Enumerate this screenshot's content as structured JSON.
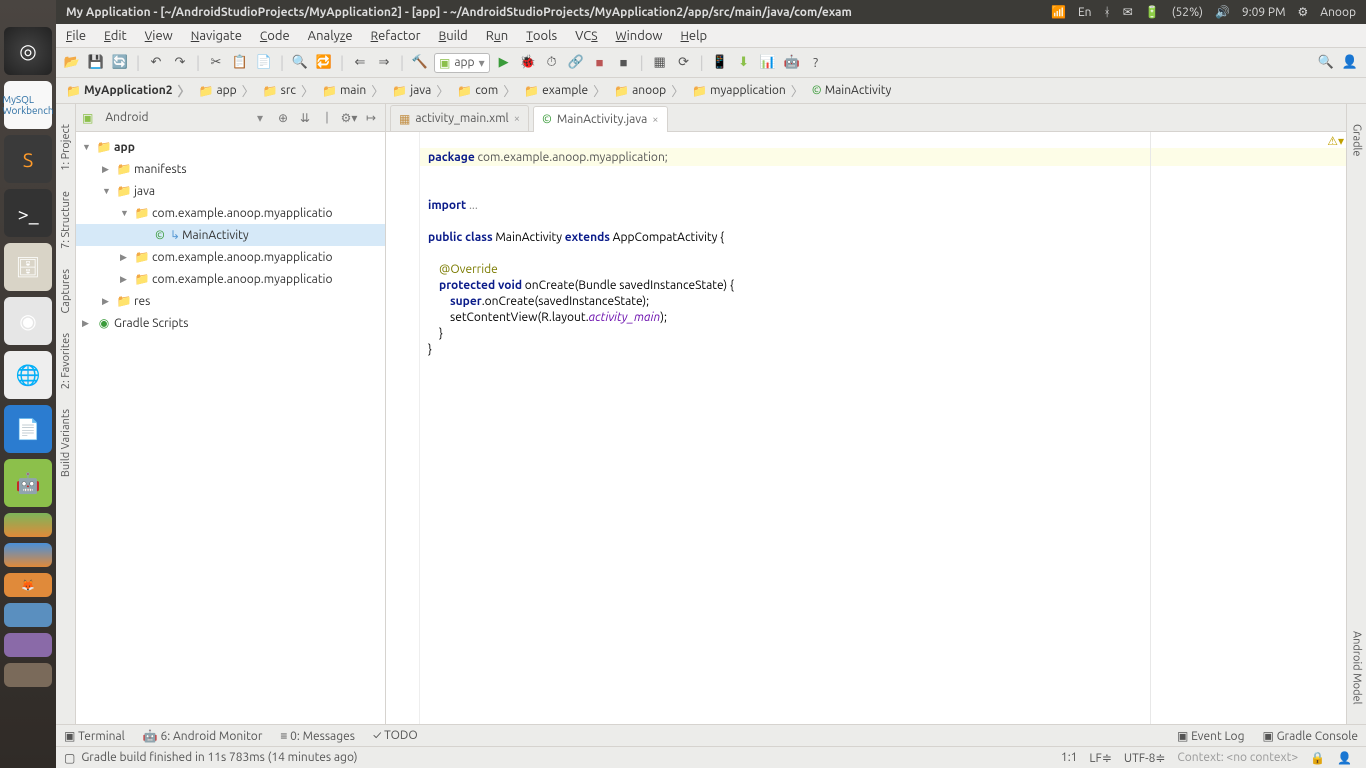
{
  "os": {
    "title": "My Application - [~/AndroidStudioProjects/MyApplication2] - [app] - ~/AndroidStudioProjects/MyApplication2/app/src/main/java/com/exam",
    "lang": "En",
    "battery": "(52%)",
    "time": "9:09 PM",
    "user": "Anoop"
  },
  "menu": {
    "file": "File",
    "edit": "Edit",
    "view": "View",
    "navigate": "Navigate",
    "code": "Code",
    "analyze": "Analyze",
    "refactor": "Refactor",
    "build": "Build",
    "run": "Run",
    "tools": "Tools",
    "vcs": "VCS",
    "window": "Window",
    "help": "Help"
  },
  "run_config": "app",
  "breadcrumb": [
    {
      "label": "MyApplication2",
      "bold": true,
      "icon": "📁"
    },
    {
      "label": "app",
      "icon": "📁"
    },
    {
      "label": "src",
      "icon": "📁"
    },
    {
      "label": "main",
      "icon": "📁"
    },
    {
      "label": "java",
      "icon": "📁"
    },
    {
      "label": "com",
      "icon": "📁"
    },
    {
      "label": "example",
      "icon": "📁"
    },
    {
      "label": "anoop",
      "icon": "📁"
    },
    {
      "label": "myapplication",
      "icon": "📁"
    },
    {
      "label": "MainActivity",
      "icon": "©"
    }
  ],
  "left_strip": [
    "1: Project",
    "7: Structure",
    "Captures",
    "2: Favorites",
    "Build Variants"
  ],
  "right_strip": [
    "Gradle",
    "Android Model"
  ],
  "project": {
    "view": "Android",
    "tree": {
      "app": "app",
      "manifests": "manifests",
      "java": "java",
      "pkg1": "com.example.anoop.myapplicatio",
      "main": "MainActivity",
      "pkg2": "com.example.anoop.myapplicatio",
      "pkg3": "com.example.anoop.myapplicatio",
      "res": "res",
      "gradle": "Gradle Scripts"
    }
  },
  "tabs": {
    "t1": "activity_main.xml",
    "t2": "MainActivity.java"
  },
  "code": {
    "l1a": "package",
    "l1b": " com.example.anoop.myapplication;",
    "l2a": "import",
    "l2b": " ...",
    "l3a": "public class",
    "l3b": " MainActivity ",
    "l3c": "extends",
    "l3d": " AppCompatActivity {",
    "l4": "@Override",
    "l5a": "protected void",
    "l5b": " onCreate(Bundle savedInstanceState) {",
    "l6a": "super",
    "l6b": ".onCreate(savedInstanceState);",
    "l7a": "        setContentView(R.layout.",
    "l7b": "activity_main",
    "l7c": ");",
    "l8": "    }",
    "l9": "}"
  },
  "bottom": {
    "terminal": "Terminal",
    "monitor": "6: Android Monitor",
    "messages": "0: Messages",
    "todo": "TODO",
    "eventlog": "Event Log",
    "gradleconsole": "Gradle Console"
  },
  "status": {
    "msg": "Gradle build finished in 11s 783ms (14 minutes ago)",
    "pos": "1:1",
    "lf": "LF≑",
    "enc": "UTF-8≑",
    "context": "Context: <no context>"
  }
}
